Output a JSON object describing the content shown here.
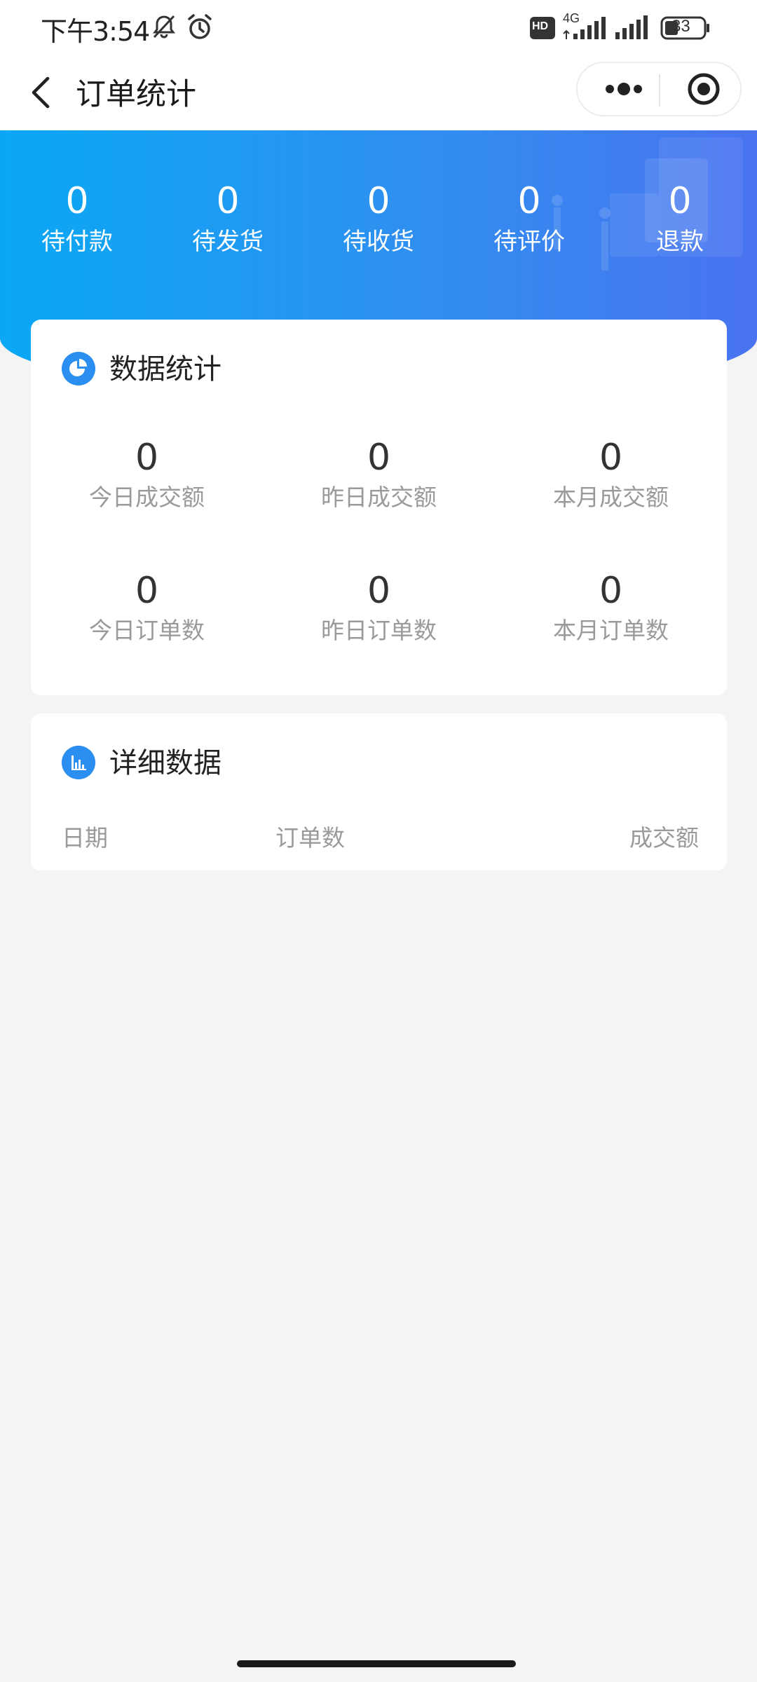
{
  "status_bar": {
    "time": "下午3:54",
    "network": "4G",
    "hd_badge": "HD",
    "battery": "33"
  },
  "nav": {
    "title": "订单统计"
  },
  "order_status": [
    {
      "count": "0",
      "label": "待付款"
    },
    {
      "count": "0",
      "label": "待发货"
    },
    {
      "count": "0",
      "label": "待收货"
    },
    {
      "count": "0",
      "label": "待评价"
    },
    {
      "count": "0",
      "label": "退款"
    }
  ],
  "stats_card": {
    "title": "数据统计",
    "items": [
      {
        "value": "0",
        "label": "今日成交额"
      },
      {
        "value": "0",
        "label": "昨日成交额"
      },
      {
        "value": "0",
        "label": "本月成交额"
      },
      {
        "value": "0",
        "label": "今日订单数"
      },
      {
        "value": "0",
        "label": "昨日订单数"
      },
      {
        "value": "0",
        "label": "本月订单数"
      }
    ]
  },
  "detail_card": {
    "title": "详细数据",
    "columns": [
      "日期",
      "订单数",
      "成交额"
    ]
  },
  "colors": {
    "accent": "#2a8ff0",
    "hero_start": "#0aa8f4",
    "hero_end": "#4a73f0"
  }
}
